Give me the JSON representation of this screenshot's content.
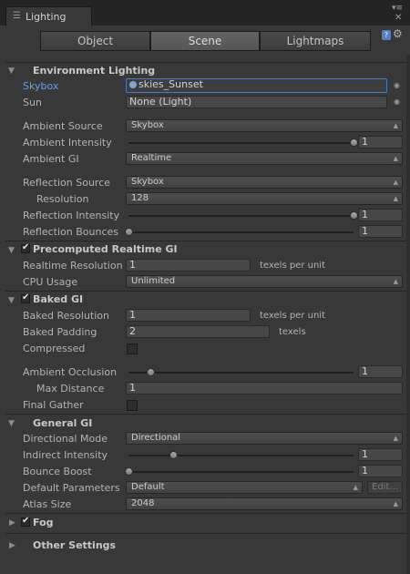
{
  "window": {
    "tab_label": "Lighting",
    "tab_icon": "lighting-menu-icon",
    "menu_icon": "window-menu-icon",
    "close_icon": "close-icon"
  },
  "mode_tabs": [
    {
      "label": "Object",
      "active": false
    },
    {
      "label": "Scene",
      "active": true
    },
    {
      "label": "Lightmaps",
      "active": false
    }
  ],
  "toolbar": {
    "help_icon": "help-icon",
    "settings_icon": "gear-icon"
  },
  "environment": {
    "title": "Environment Lighting",
    "skybox_label": "Skybox",
    "skybox_value": "skies_Sunset",
    "sun_label": "Sun",
    "sun_value": "None (Light)",
    "ambient_source_label": "Ambient Source",
    "ambient_source_value": "Skybox",
    "ambient_intensity_label": "Ambient Intensity",
    "ambient_intensity_value": "1",
    "ambient_intensity_fraction": 1.0,
    "ambient_gi_label": "Ambient GI",
    "ambient_gi_value": "Realtime",
    "reflection_source_label": "Reflection Source",
    "reflection_source_value": "Skybox",
    "resolution_label": "Resolution",
    "resolution_value": "128",
    "reflection_intensity_label": "Reflection Intensity",
    "reflection_intensity_value": "1",
    "reflection_intensity_fraction": 1.0,
    "reflection_bounces_label": "Reflection Bounces",
    "reflection_bounces_value": "1",
    "reflection_bounces_fraction": 0.0
  },
  "precomputed": {
    "title": "Precomputed Realtime GI",
    "enabled": true,
    "realtime_resolution_label": "Realtime Resolution",
    "realtime_resolution_value": "1",
    "realtime_resolution_unit": "texels per unit",
    "cpu_usage_label": "CPU Usage",
    "cpu_usage_value": "Unlimited"
  },
  "baked": {
    "title": "Baked GI",
    "enabled": true,
    "baked_resolution_label": "Baked Resolution",
    "baked_resolution_value": "1",
    "baked_resolution_unit": "texels per unit",
    "baked_padding_label": "Baked Padding",
    "baked_padding_value": "2",
    "baked_padding_unit": "texels",
    "compressed_label": "Compressed",
    "compressed_checked": false,
    "ambient_occlusion_label": "Ambient Occlusion",
    "ambient_occlusion_value": "1",
    "ambient_occlusion_fraction": 0.1,
    "max_distance_label": "Max Distance",
    "max_distance_value": "1",
    "final_gather_label": "Final Gather",
    "final_gather_checked": false
  },
  "general": {
    "title": "General GI",
    "directional_mode_label": "Directional Mode",
    "directional_mode_value": "Directional",
    "indirect_intensity_label": "Indirect Intensity",
    "indirect_intensity_value": "1",
    "indirect_intensity_fraction": 0.2,
    "bounce_boost_label": "Bounce Boost",
    "bounce_boost_value": "1",
    "bounce_boost_fraction": 0.0,
    "default_parameters_label": "Default Parameters",
    "default_parameters_value": "Default",
    "edit_label": "Edit...",
    "atlas_size_label": "Atlas Size",
    "atlas_size_value": "2048"
  },
  "fog": {
    "title": "Fog",
    "enabled": true
  },
  "other": {
    "title": "Other Settings"
  },
  "colors": {
    "background": "#383838",
    "selected_label": "#6e9fe6",
    "focus_border": "#4a78c8"
  }
}
